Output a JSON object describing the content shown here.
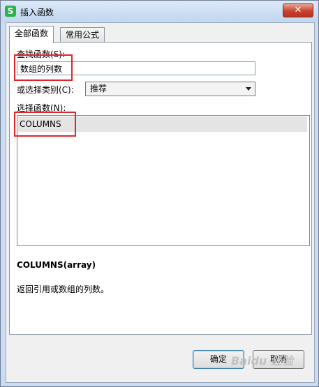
{
  "window": {
    "title": "插入函数",
    "close_label": "✕",
    "app_icon": "S"
  },
  "tabs": [
    {
      "label": "全部函数",
      "active": true
    },
    {
      "label": "常用公式",
      "active": false
    }
  ],
  "search": {
    "label": "查找函数(S):",
    "value": "数组的列数"
  },
  "category": {
    "label": "或选择类别(C):",
    "selected": "推荐"
  },
  "function_list": {
    "label": "选择函数(N):",
    "items": [
      "COLUMNS"
    ]
  },
  "signature": "COLUMNS(array)",
  "description": "返回引用或数组的列数。",
  "buttons": {
    "ok": "确定",
    "cancel": "取消"
  },
  "watermark": "Baidu 经验",
  "accent_colors": {
    "highlight_box": "#e0262b",
    "selected_row": "#e4e4e4",
    "title_bar": "#c9dcf2"
  }
}
